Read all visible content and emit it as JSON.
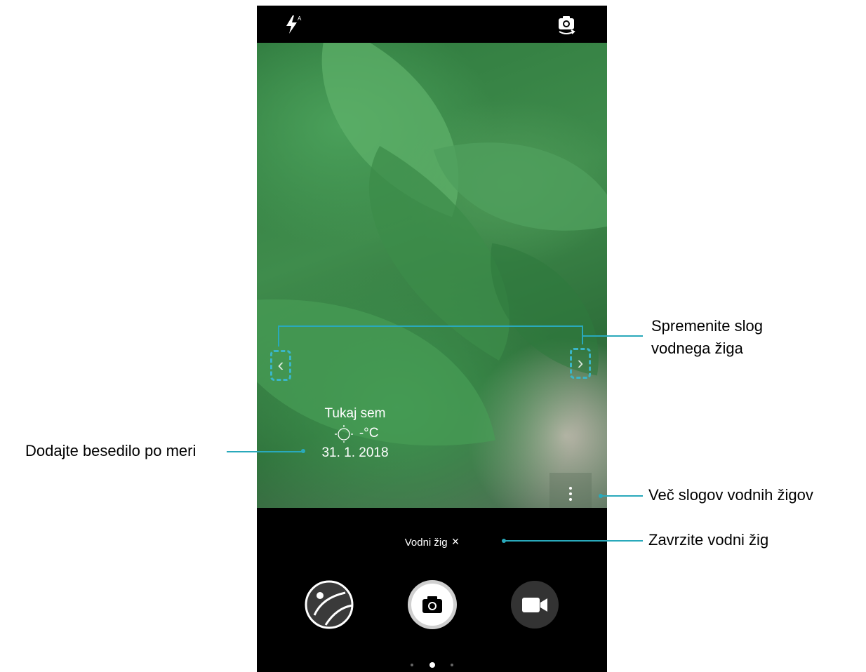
{
  "topbar": {
    "flash_icon": "flash-auto-icon",
    "switch_camera_icon": "switch-camera-icon"
  },
  "watermark": {
    "location_text": "Tukaj sem",
    "weather_icon": "sun-icon",
    "temperature": "-°C",
    "date": "31. 1. 2018"
  },
  "bottom": {
    "watermark_chip_label": "Vodni žig",
    "watermark_chip_close": "×",
    "gallery_icon": "gallery-thumbnail-icon",
    "shutter_icon": "camera-shutter-icon",
    "video_icon": "video-camera-icon"
  },
  "callouts": {
    "change_style": [
      "Spremenite slog",
      "vodnega žiga"
    ],
    "add_text": "Dodajte besedilo po meri",
    "more_styles": "Več slogov vodnih žigov",
    "discard": "Zavrzite vodni žig"
  },
  "colors": {
    "callout_line": "#29a9bb",
    "camera_background": "#000000"
  }
}
